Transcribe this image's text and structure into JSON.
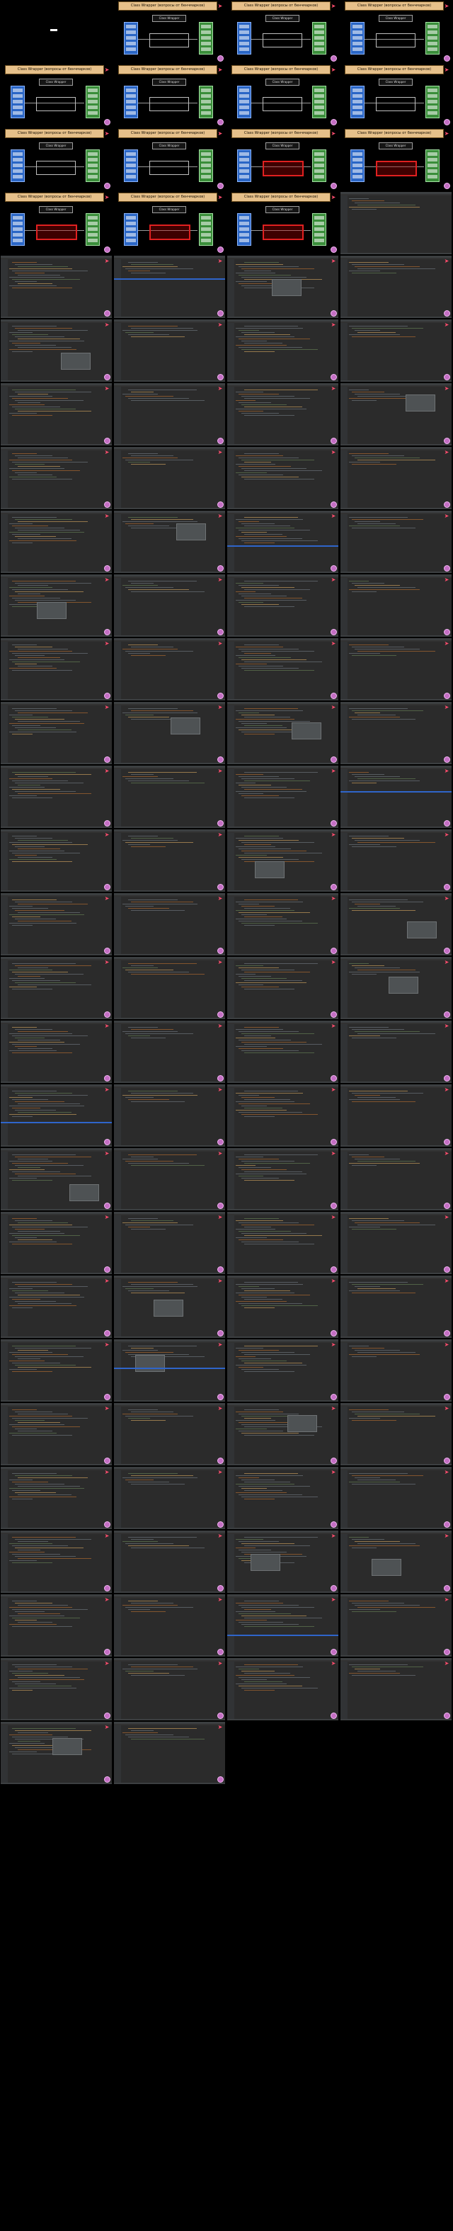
{
  "banner_text": "Class Wrapper (вопросы от бенчмарков)",
  "box_title": "Class Wrapper",
  "logo_glyph": "➤",
  "layout": {
    "cols": 4,
    "slide_rows": 4
  },
  "frames": [
    {
      "kind": "slide-blank"
    },
    {
      "kind": "slide",
      "variant": "plain"
    },
    {
      "kind": "slide",
      "variant": "plain"
    },
    {
      "kind": "slide",
      "variant": "plain"
    },
    {
      "kind": "slide",
      "variant": "plain"
    },
    {
      "kind": "slide",
      "variant": "plain"
    },
    {
      "kind": "slide",
      "variant": "plain"
    },
    {
      "kind": "slide",
      "variant": "plain"
    },
    {
      "kind": "slide",
      "variant": "plain"
    },
    {
      "kind": "slide",
      "variant": "plain"
    },
    {
      "kind": "slide",
      "variant": "red"
    },
    {
      "kind": "slide",
      "variant": "red"
    },
    {
      "kind": "slide",
      "variant": "red"
    },
    {
      "kind": "slide",
      "variant": "red"
    },
    {
      "kind": "slide",
      "variant": "red"
    },
    {
      "kind": "ide",
      "variant": "start"
    }
  ],
  "ide_frames": 94
}
